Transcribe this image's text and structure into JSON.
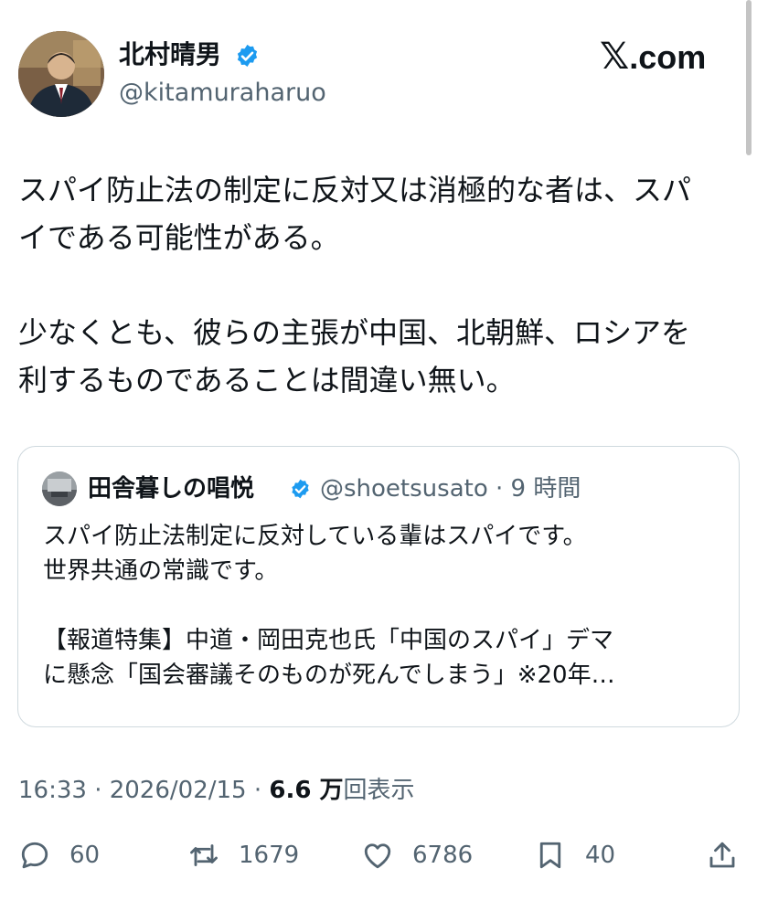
{
  "author": {
    "display_name": "北村晴男",
    "handle": "@kitamuraharuo",
    "verified": true
  },
  "brand": {
    "x_glyph": "𝕏",
    "suffix": ".com"
  },
  "post": {
    "lines": [
      "スパイ防止法の制定に反対又は消極的な者は、スパ",
      "イである可能性がある。",
      "",
      "少なくとも、彼らの主張が中国、北朝鮮、ロシアを",
      "利するものであることは間違い無い。"
    ]
  },
  "quote": {
    "display_name": "田舎暮しの唱悦",
    "handle_time": "@shoetsusato · 9 時間",
    "verified": true,
    "lines": [
      "スパイ防止法制定に反対している輩はスパイです。",
      "世界共通の常識です。",
      "",
      "【報道特集】中道・岡田克也氏「中国のスパイ」デマ",
      "に懸念「国会審議そのものが死んでしまう」※20年…"
    ]
  },
  "meta": {
    "time_date": "16:33 · 2026/02/15 · ",
    "views_value": "6.6 万",
    "views_label": "回表示"
  },
  "actions": {
    "replies": "60",
    "reposts": "1679",
    "likes": "6786",
    "bookmarks": "40"
  },
  "colors": {
    "verified_blue": "#1d9bf0",
    "text": "#0f1419",
    "secondary_text": "#536471",
    "border": "#cfd9de"
  },
  "icons": [
    "verified-badge-icon",
    "reply-icon",
    "repost-icon",
    "like-icon",
    "bookmark-icon",
    "share-icon"
  ]
}
